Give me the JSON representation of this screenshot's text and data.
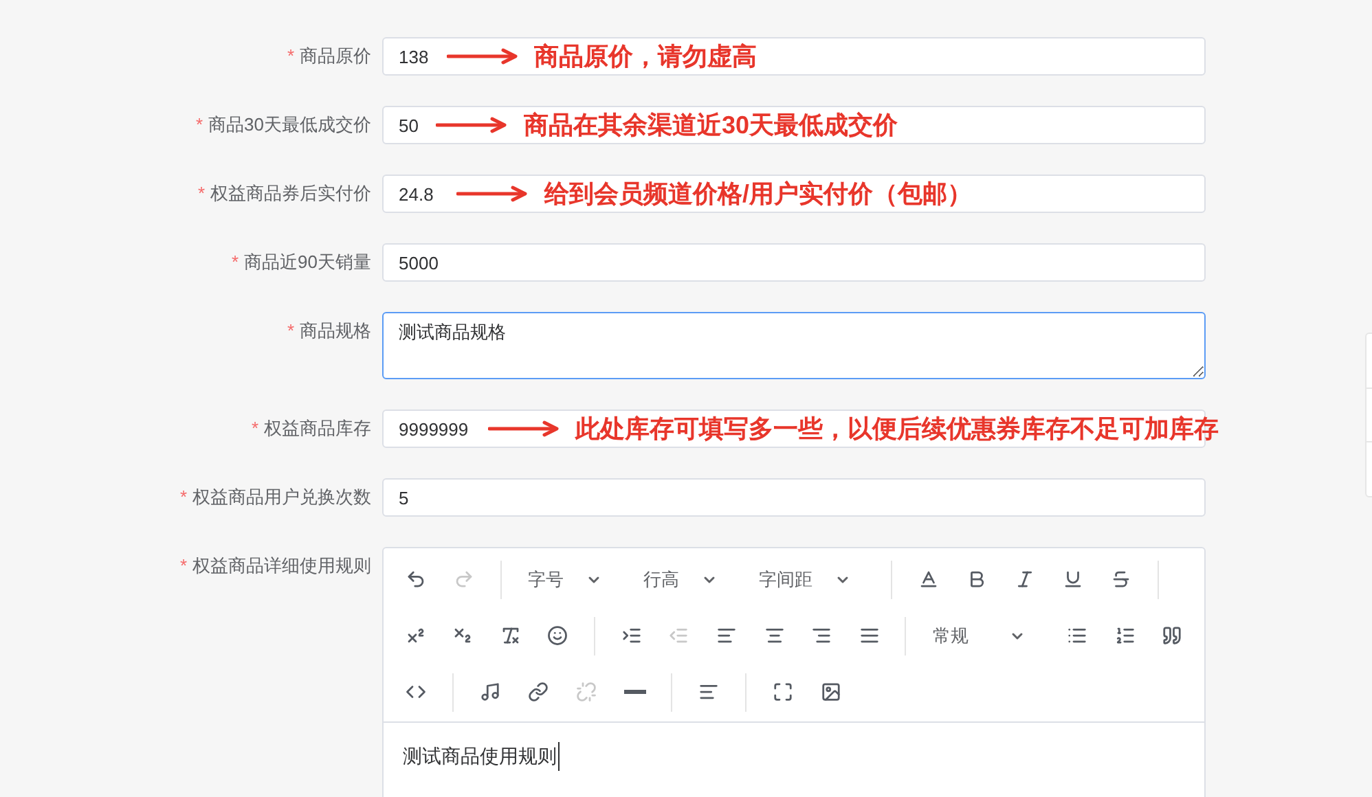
{
  "fields": [
    {
      "label": "商品原价",
      "required_mark": "*",
      "kind": "input",
      "value": "138",
      "annotation": "商品原价，请勿虚高"
    },
    {
      "label": "商品30天最低成交价",
      "required_mark": "*",
      "kind": "input",
      "value": "50",
      "annotation": "商品在其余渠道近30天最低成交价"
    },
    {
      "label": "权益商品券后实付价",
      "required_mark": "*",
      "kind": "input",
      "value": "24.8",
      "annotation": "给到会员频道价格/用户实付价（包邮）"
    },
    {
      "label": "商品近90天销量",
      "required_mark": "*",
      "kind": "input",
      "value": "5000"
    },
    {
      "label": "商品规格",
      "required_mark": "*",
      "kind": "textarea",
      "value": "测试商品规格"
    },
    {
      "label": "权益商品库存",
      "required_mark": "*",
      "kind": "input",
      "value": "9999999",
      "annotation": "此处库存可填写多一些，以便后续优惠券库存不足可加库存"
    },
    {
      "label": "权益商品用户兑换次数",
      "required_mark": "*",
      "kind": "input",
      "value": "5"
    },
    {
      "label": "权益商品详细使用规则",
      "required_mark": "*",
      "kind": "editor",
      "value": "测试商品使用规则"
    }
  ],
  "toolbar": [
    [
      {
        "kind": "button",
        "disabled": false
      },
      {
        "kind": "button",
        "disabled": true
      },
      {
        "kind": "divider"
      },
      {
        "kind": "select",
        "label": "字号"
      },
      {
        "kind": "select",
        "label": "行高"
      },
      {
        "kind": "select",
        "label": "字间距"
      },
      {
        "kind": "divider"
      },
      {
        "kind": "button",
        "disabled": false
      },
      {
        "kind": "button",
        "disabled": false
      },
      {
        "kind": "button",
        "disabled": false
      },
      {
        "kind": "button",
        "disabled": false
      },
      {
        "kind": "button",
        "disabled": false
      },
      {
        "kind": "divider"
      }
    ],
    [
      {
        "kind": "button",
        "disabled": false
      },
      {
        "kind": "button",
        "disabled": false
      },
      {
        "kind": "button",
        "disabled": false
      },
      {
        "kind": "button",
        "disabled": false
      },
      {
        "kind": "divider"
      },
      {
        "kind": "button",
        "disabled": false
      },
      {
        "kind": "button",
        "disabled": true
      },
      {
        "kind": "button",
        "disabled": false
      },
      {
        "kind": "button",
        "disabled": false
      },
      {
        "kind": "button",
        "disabled": false
      },
      {
        "kind": "button",
        "disabled": false
      },
      {
        "kind": "divider"
      },
      {
        "kind": "select",
        "label": "常规"
      },
      {
        "kind": "button",
        "disabled": false
      },
      {
        "kind": "button",
        "disabled": false
      },
      {
        "kind": "button",
        "disabled": false
      }
    ],
    [
      {
        "kind": "button",
        "disabled": false
      },
      {
        "kind": "divider"
      },
      {
        "kind": "button",
        "disabled": false
      },
      {
        "kind": "button",
        "disabled": false
      },
      {
        "kind": "button",
        "disabled": true
      },
      {
        "kind": "button",
        "disabled": false
      },
      {
        "kind": "divider"
      },
      {
        "kind": "button",
        "disabled": false
      },
      {
        "kind": "divider"
      },
      {
        "kind": "button",
        "disabled": false
      },
      {
        "kind": "button",
        "disabled": false
      }
    ]
  ]
}
